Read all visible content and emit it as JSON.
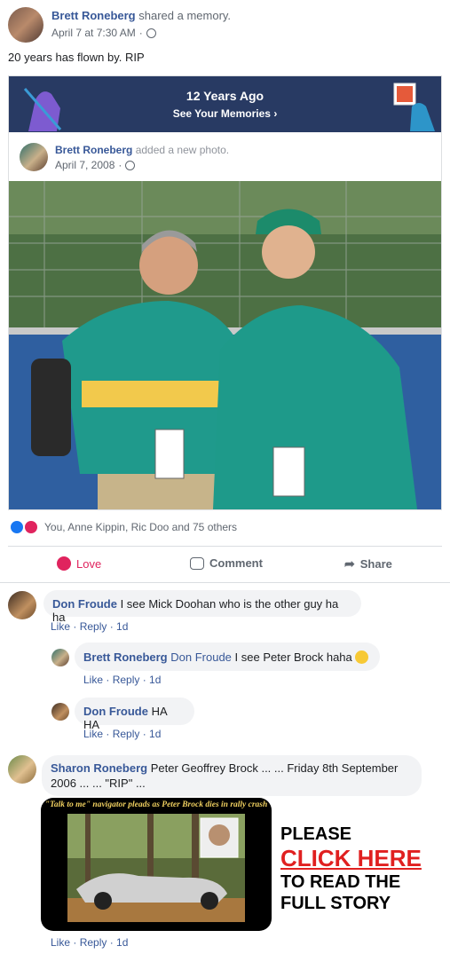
{
  "post": {
    "author": "Brett Roneberg",
    "action": "shared a memory.",
    "date": "April 7 at 7:30 AM",
    "text": "20 years has flown by. RIP"
  },
  "memory": {
    "title": "12 Years Ago",
    "subtitle": "See Your Memories"
  },
  "inner_post": {
    "author": "Brett Roneberg",
    "action": "added a new photo.",
    "date": "April 7, 2008"
  },
  "reactions": {
    "text": "You, Anne Kippin, Ric Doo and 75 others"
  },
  "actions": {
    "love": "Love",
    "comment": "Comment",
    "share": "Share"
  },
  "comments": [
    {
      "author": "Don Froude",
      "text": "I see Mick Doohan who is the other guy ha ha",
      "like": "Like",
      "reply": "Reply",
      "time": "1d"
    },
    {
      "author": "Brett Roneberg",
      "mention": "Don Froude",
      "text": "I see Peter Brock haha",
      "like": "Like",
      "reply": "Reply",
      "time": "1d"
    },
    {
      "author": "Don Froude",
      "text": "HA HA",
      "like": "Like",
      "reply": "Reply",
      "time": "1d"
    },
    {
      "author": "Sharon Roneberg",
      "text": "Peter Geoffrey Brock ... ... Friday 8th September 2006 ... ... \"RIP\" ...",
      "like": "Like",
      "reply": "Reply",
      "time": "1d"
    }
  ],
  "attachment": {
    "headline": "\"Talk to me\" navigator pleads as Peter Brock dies in rally crash",
    "promo_line1": "PLEASE",
    "promo_link": "CLICK HERE",
    "promo_line2": "TO READ THE",
    "promo_line3": "FULL STORY"
  },
  "colors": {
    "banner": "#283a63",
    "link": "#385898",
    "love": "#e0245e",
    "like": "#1877f2",
    "promo_red": "#e02020"
  }
}
